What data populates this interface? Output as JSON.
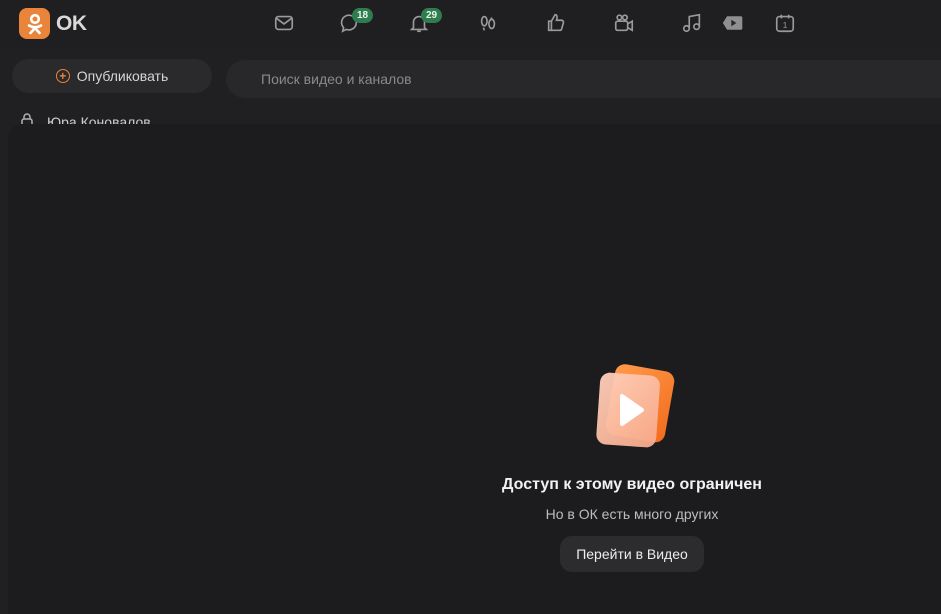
{
  "header": {
    "logo_text": "OK",
    "nav": [
      {
        "name": "messages-icon"
      },
      {
        "name": "discussions-icon",
        "badge": "18"
      },
      {
        "name": "notifications-icon",
        "badge": "29"
      },
      {
        "name": "guests-icon"
      },
      {
        "name": "likes-icon"
      },
      {
        "name": "video-camera-icon"
      },
      {
        "name": "music-icon"
      },
      {
        "name": "video-play-icon"
      },
      {
        "name": "calendar-icon",
        "day": "1"
      }
    ]
  },
  "sidebar": {
    "publish_label": "Опубликовать",
    "profile_name": "Юра Коновалов"
  },
  "search": {
    "placeholder": "Поиск видео и каналов"
  },
  "restricted": {
    "title": "Доступ к этому видео ограничен",
    "subtitle": "Но в ОК есть много других",
    "button_label": "Перейти в Видео"
  },
  "colors": {
    "accent": "#e9843a",
    "badge": "#2f7d4f",
    "background": "#1c1c1e"
  }
}
